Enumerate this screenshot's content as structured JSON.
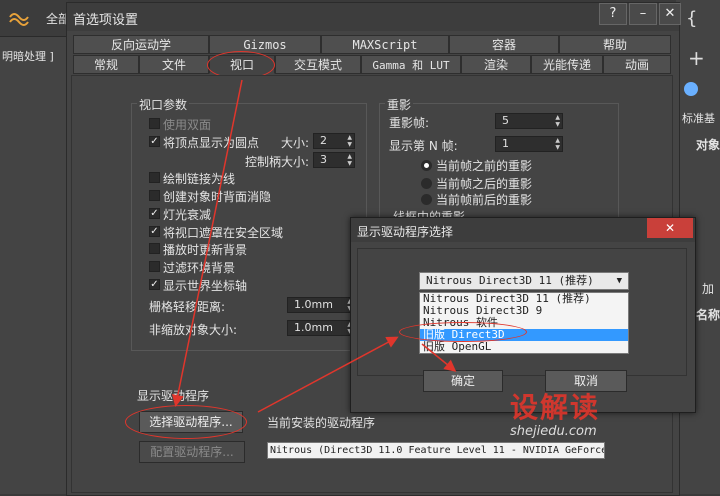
{
  "app": {
    "left_label": "全部",
    "left_hint": "明暗处理 ]",
    "right_labels": [
      "标准基",
      "对象",
      "加",
      "名称"
    ]
  },
  "preferences": {
    "title": "首选项设置",
    "help_btn": "?",
    "minimize_btn": "–",
    "close_btn": "✕",
    "tabs_row1": [
      "反向运动学",
      "Gizmos",
      "MAXScript",
      "容器",
      "帮助"
    ],
    "tabs_row2": [
      "常规",
      "文件",
      "视口",
      "交互模式",
      "Gamma 和 LUT",
      "渲染",
      "光能传递",
      "动画"
    ],
    "active_tab": "视口",
    "viewport_params": {
      "title": "视口参数",
      "use_dual_planes": "使用双面",
      "show_verts_dots": "将顶点显示为圆点",
      "size_label": "大小:",
      "size_value": "2",
      "handle_size_label": "控制柄大小:",
      "handle_size_value": "3",
      "draw_links": "绘制链接为线",
      "backface_cull": "创建对象时背面消隐",
      "attenuate_lights": "灯光衰减",
      "mask_safe": "将视口遮罩在安全区域",
      "update_bg_play": "播放时更新背景",
      "filter_env_bg": "过滤环境背景",
      "show_world_axis": "显示世界坐标轴",
      "grid_nudge_label": "栅格轻移距离:",
      "grid_nudge_value": "1.0mm",
      "nonscale_label": "非缩放对象大小:",
      "nonscale_value": "1.0mm"
    },
    "ghosting": {
      "title": "重影",
      "frames_label": "重影帧:",
      "frames_value": "5",
      "nth_label": "显示第 N 帧:",
      "nth_value": "1",
      "before": "当前帧之前的重影",
      "after": "当前帧之后的重影",
      "both": "当前帧前后的重影",
      "wireframe": "线框中的重影"
    },
    "display_drivers": {
      "title": "显示驱动程序",
      "choose_btn": "选择驱动程序...",
      "configure_btn": "配置驱动程序...",
      "installed_label": "当前安装的驱动程序",
      "installed_value": "Nitrous (Direct3D 11.0 Feature Level 11 - NVIDIA GeForce"
    }
  },
  "driver_dialog": {
    "title": "显示驱动程序选择",
    "close_btn": "✕",
    "combo_value": "Nitrous Direct3D 11 (推荐)",
    "options": [
      "Nitrous Direct3D 11 (推荐)",
      "Nitrous Direct3D 9",
      "Nitrous 软件",
      "旧版 Direct3D",
      "旧版 OpenGL"
    ],
    "selected_option": "旧版 Direct3D",
    "ok_btn": "确定",
    "cancel_btn": "取消"
  },
  "watermark": {
    "brand": "设解读",
    "url": "shejiedu.com"
  },
  "colors": {
    "annotation_red": "#e0362c",
    "selection_blue": "#3399ff"
  }
}
